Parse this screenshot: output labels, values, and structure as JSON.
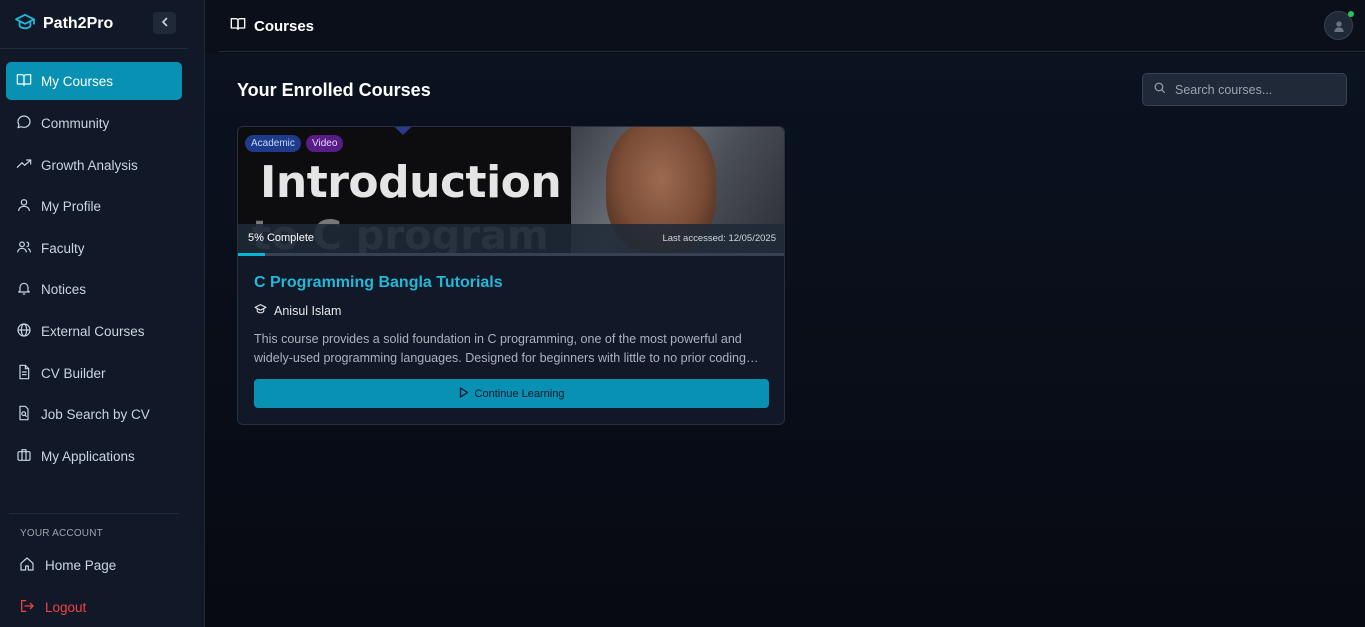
{
  "brand": {
    "name": "Path2Pro"
  },
  "sidebar": {
    "items": [
      {
        "label": "My Courses",
        "icon": "book-open-icon",
        "active": true
      },
      {
        "label": "Community",
        "icon": "chat-bubble-icon"
      },
      {
        "label": "Growth Analysis",
        "icon": "trending-up-icon"
      },
      {
        "label": "My Profile",
        "icon": "user-icon"
      },
      {
        "label": "Faculty",
        "icon": "users-icon"
      },
      {
        "label": "Notices",
        "icon": "bell-icon"
      },
      {
        "label": "External Courses",
        "icon": "globe-icon"
      },
      {
        "label": "CV Builder",
        "icon": "document-icon"
      },
      {
        "label": "Job Search by CV",
        "icon": "file-search-icon"
      },
      {
        "label": "My Applications",
        "icon": "briefcase-icon"
      }
    ],
    "account_label": "YOUR ACCOUNT",
    "account_items": [
      {
        "label": "Home Page",
        "icon": "home-icon"
      },
      {
        "label": "Logout",
        "icon": "logout-icon"
      }
    ]
  },
  "header": {
    "title": "Courses"
  },
  "main": {
    "section_title": "Your Enrolled Courses",
    "search": {
      "placeholder": "Search courses...",
      "value": ""
    },
    "courses": [
      {
        "tags": [
          "Academic",
          "Video"
        ],
        "thumbnail_text": [
          "Introduction",
          "to C program"
        ],
        "progress_label": "5% Complete",
        "progress": 0.05,
        "last_accessed": "Last accessed: 12/05/2025",
        "title": "C Programming Bangla Tutorials",
        "instructor": "Anisul Islam",
        "description": "This course provides a solid foundation in C programming, one of the most powerful and widely-used programming languages. Designed for beginners with little to no prior coding experience.",
        "cta_label": "Continue Learning"
      }
    ]
  },
  "colors": {
    "accent": "#0891b2",
    "title_accent": "#22b8d8",
    "background": "#0b0f1a",
    "sidebar": "#111827",
    "danger": "#ef4444",
    "online": "#22c55e"
  }
}
